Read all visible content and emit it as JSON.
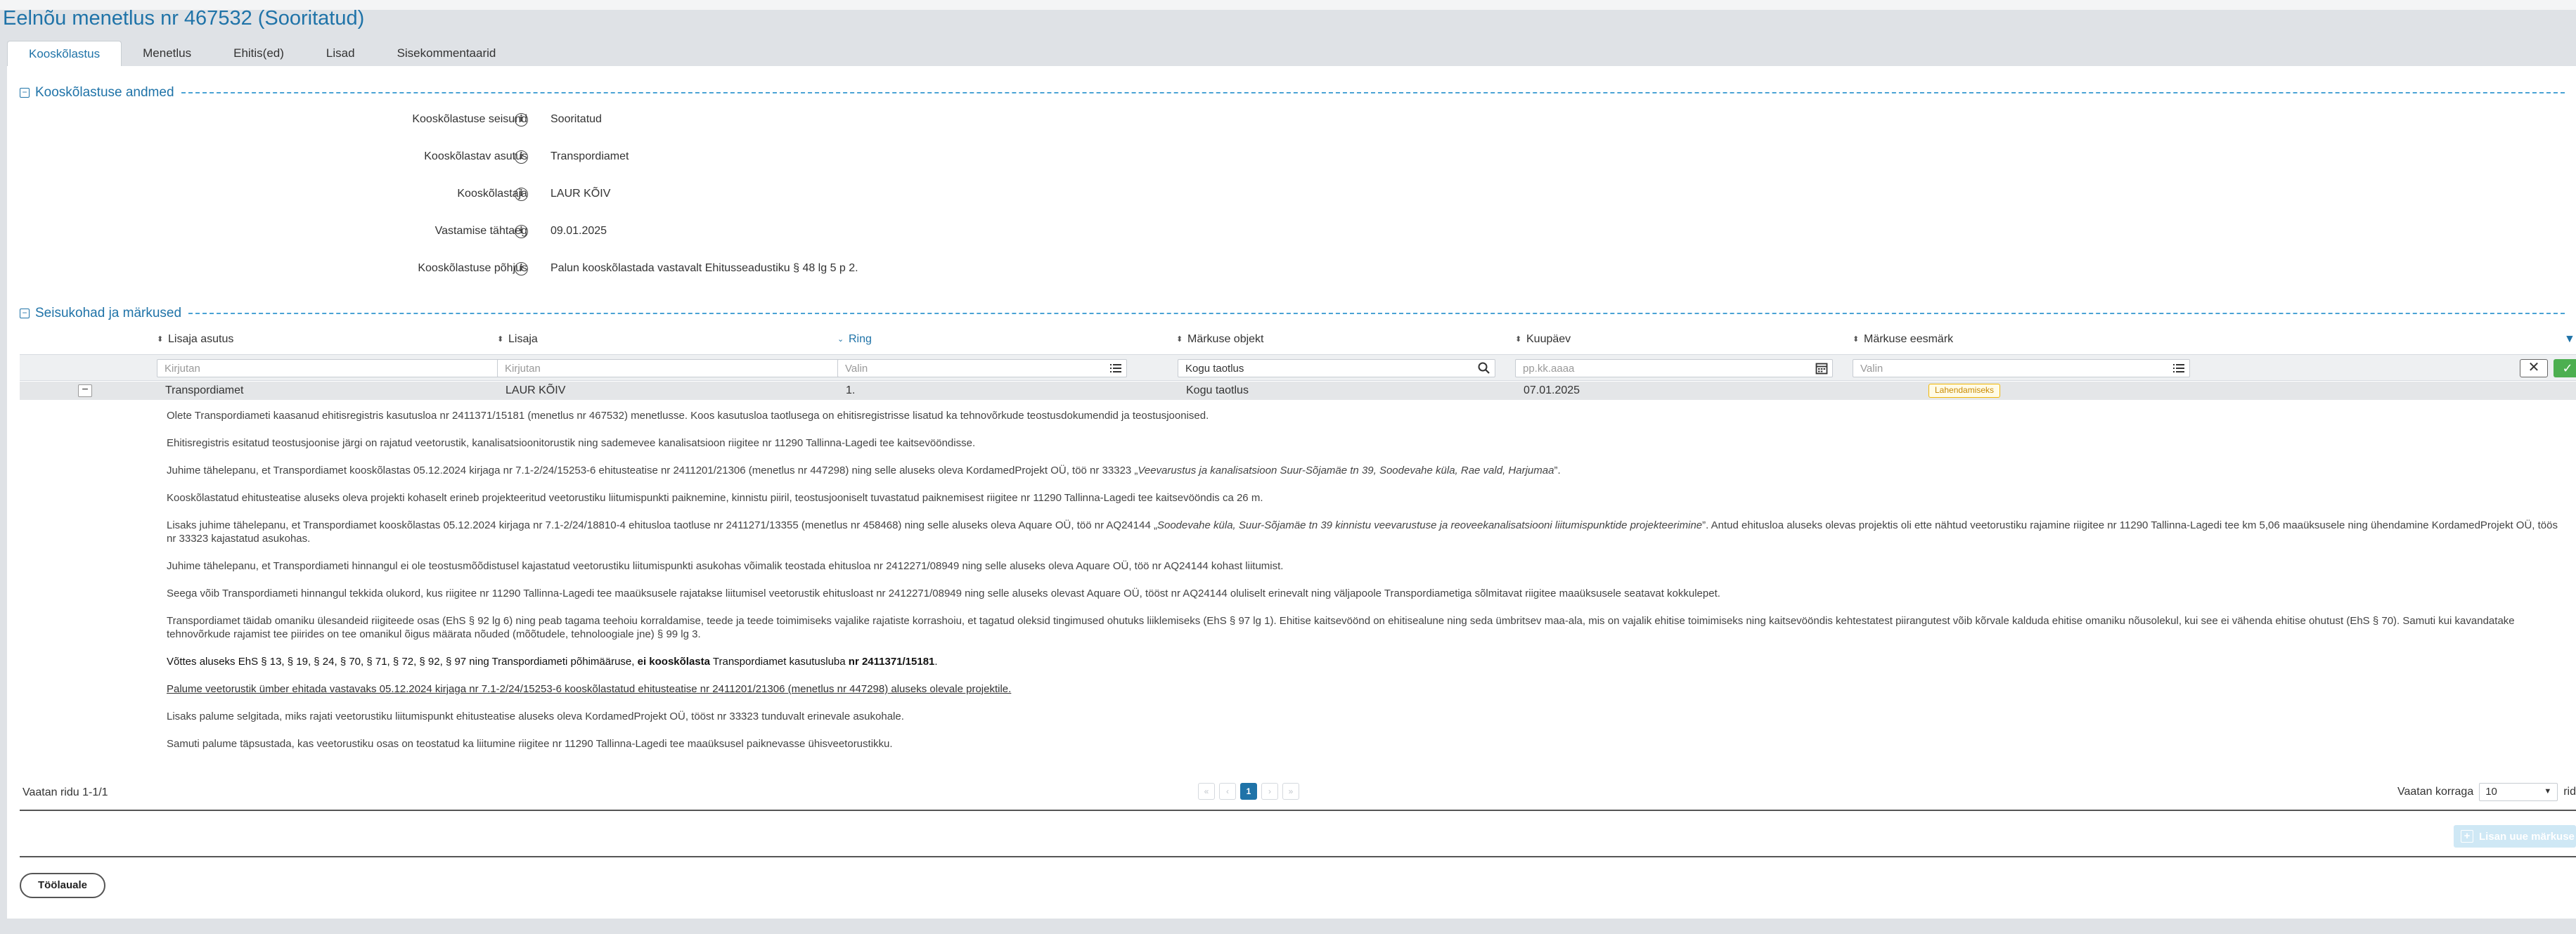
{
  "page_title": "Eelnõu menetlus nr 467532 (Sooritatud)",
  "tabs": [
    {
      "label": "Kooskõlastus"
    },
    {
      "label": "Menetlus"
    },
    {
      "label": "Ehitis(ed)"
    },
    {
      "label": "Lisad"
    },
    {
      "label": "Sisekommentaarid"
    }
  ],
  "section1": {
    "title": "Kooskõlastuse andmed",
    "rows": [
      {
        "label": "Kooskõlastuse seisund",
        "value": "Sooritatud"
      },
      {
        "label": "Kooskõlastav asutus",
        "value": "Transpordiamet"
      },
      {
        "label": "Kooskõlastaja",
        "value": "LAUR KÕIV"
      },
      {
        "label": "Vastamise tähtaeg",
        "value": "09.01.2025"
      },
      {
        "label": "Kooskõlastuse põhjus",
        "value": "Palun kooskõlastada vastavalt Ehitusseadustiku § 48 lg 5 p 2."
      }
    ]
  },
  "section2": {
    "title": "Seisukohad ja märkused"
  },
  "grid": {
    "columns": [
      {
        "label": "Lisaja asutus"
      },
      {
        "label": "Lisaja"
      },
      {
        "label": "Ring"
      },
      {
        "label": "Märkuse objekt"
      },
      {
        "label": "Kuupäev"
      },
      {
        "label": "Märkuse eesmärk"
      }
    ],
    "filters": [
      {
        "placeholder": "Kirjutan"
      },
      {
        "placeholder": "Kirjutan"
      },
      {
        "placeholder": "Valin"
      },
      {
        "value": "Kogu taotlus"
      },
      {
        "placeholder": "pp.kk.aaaa"
      },
      {
        "placeholder": "Valin"
      }
    ],
    "row": {
      "org": "Transpordiamet",
      "author": "LAUR KÕIV",
      "round": "1.",
      "object": "Kogu taotlus",
      "date": "07.01.2025",
      "purpose": "Lahendamiseks"
    }
  },
  "details": {
    "p1": "Olete Transpordiameti kaasanud ehitisregistris kasutusloa nr 2411371/15181 (menetlus nr 467532) menetlusse. Koos kasutusloa taotlusega on ehitisregistrisse lisatud ka tehnovõrkude teostusdokumendid ja teostusjoonised.",
    "p2": "Ehitisregistris esitatud teostusjoonise järgi on rajatud veetorustik, kanalisatsioonitorustik ning sademevee kanalisatsioon riigitee nr 11290 Tallinna-Lagedi tee kaitsevööndisse.",
    "p3a": "Juhime tähelepanu, et Transpordiamet kooskõlastas 05.12.2024 kirjaga nr 7.1-2/24/15253-6 ehitusteatise nr 2411201/21306 (menetlus nr 447298) ning selle aluseks oleva KordamedProjekt OÜ, töö nr 33323 „",
    "p3b": "Veevarustus ja kanalisatsioon Suur-Sõjamäe tn 39, Soodevahe küla, Rae vald, Harjumaa",
    "p3c": "”.",
    "p4": "Kooskõlastatud ehitusteatise aluseks oleva projekti kohaselt erineb projekteeritud veetorustiku liitumispunkti paiknemine, kinnistu piiril, teostusjooniselt tuvastatud paiknemisest riigitee nr 11290 Tallinna-Lagedi tee kaitsevööndis ca 26 m.",
    "p5a": "Lisaks juhime tähelepanu, et Transpordiamet kooskõlastas 05.12.2024 kirjaga nr 7.1-2/24/18810-4 ehitusloa taotluse nr 2411271/13355 (menetlus nr 458468) ning selle aluseks oleva Aquare OÜ, töö nr AQ24144 „",
    "p5b": "Soodevahe küla, Suur-Sõjamäe tn 39 kinnistu veevarustuse ja reoveekanalisatsiooni liitumispunktide projekteerimine",
    "p5c": "”. Antud ehitusloa aluseks olevas projektis oli ette nähtud veetorustiku rajamine riigitee nr 11290 Tallinna-Lagedi tee km 5,06 maaüksusele ning ühendamine KordamedProjekt OÜ, töös nr 33323 kajastatud asukohas.",
    "p6": "Juhime tähelepanu, et Transpordiameti hinnangul ei ole teostusmõõdistusel kajastatud veetorustiku liitumispunkti asukohas võimalik teostada ehitusloa nr 2412271/08949 ning selle aluseks oleva Aquare OÜ, töö nr AQ24144 kohast liitumist.",
    "p7": "Seega võib Transpordiameti hinnangul tekkida olukord, kus riigitee nr 11290 Tallinna-Lagedi tee maaüksusele rajatakse liitumisel veetorustik ehitusloast nr 2412271/08949 ning selle aluseks olevast Aquare OÜ, tööst nr AQ24144 oluliselt erinevalt ning väljapoole Transpordiametiga sõlmitavat riigitee maaüksusele seatavat kokkulepet.",
    "p8": "Transpordiamet täidab omaniku ülesandeid riigiteede osas (EhS § 92 lg 6) ning peab tagama teehoiu korraldamise, teede ja teede toimimiseks vajalike rajatiste korrashoiu, et tagatud oleksid tingimused ohutuks liiklemiseks (EhS § 97 lg 1). Ehitise kaitsevöönd on ehitisealune ning seda ümbritsev maa-ala, mis on vajalik ehitise toimimiseks ning kaitsevööndis kehtestatest piirangutest võib kõrvale kalduda ehitise omaniku nõusolekul, kui see ei vähenda ehitise ohutust (EhS § 70). Samuti kui kavandatake tehnovõrkude rajamist tee piirides on tee omanikul õigus määrata nõuded (mõõtudele, tehnoloogiale jne) § 99 lg 3.",
    "p9a": "Võttes aluseks EhS § 13, § 19, § 24, § 70, § 71, § 72, § 92, § 97 ning Transpordiameti põhimääruse, ",
    "p9b": "ei kooskõlasta",
    "p9c": " Transpordiamet kasutusluba ",
    "p9d": "nr 2411371/15181",
    "p9e": ".",
    "p10": "Palume veetorustik ümber ehitada vastavaks 05.12.2024 kirjaga nr 7.1-2/24/15253-6 kooskõlastatud ehitusteatise nr 2411201/21306 (menetlus nr 447298) aluseks olevale projektile.",
    "p11": "Lisaks palume selgitada, miks rajati veetorustiku liitumispunkt ehitusteatise aluseks oleva KordamedProjekt OÜ, tööst nr 33323 tunduvalt erinevale asukohale.",
    "p12": "Samuti palume täpsustada, kas veetorustiku osas on teostatud ka liitumine riigitee nr 11290 Tallinna-Lagedi tee maaüksusel paiknevasse ühisveetorustikku."
  },
  "pager": {
    "left": "Vaatan ridu 1-1/1",
    "current": "1",
    "right_prefix": "Vaatan korraga",
    "page_size": "10",
    "right_suffix": "rida"
  },
  "add_remark_label": "Lisan uue märkuse",
  "back_button": "Töölauale",
  "colors": {
    "accent": "#1f73a8",
    "badge_border": "#f2b705",
    "ok": "#4caf50"
  }
}
